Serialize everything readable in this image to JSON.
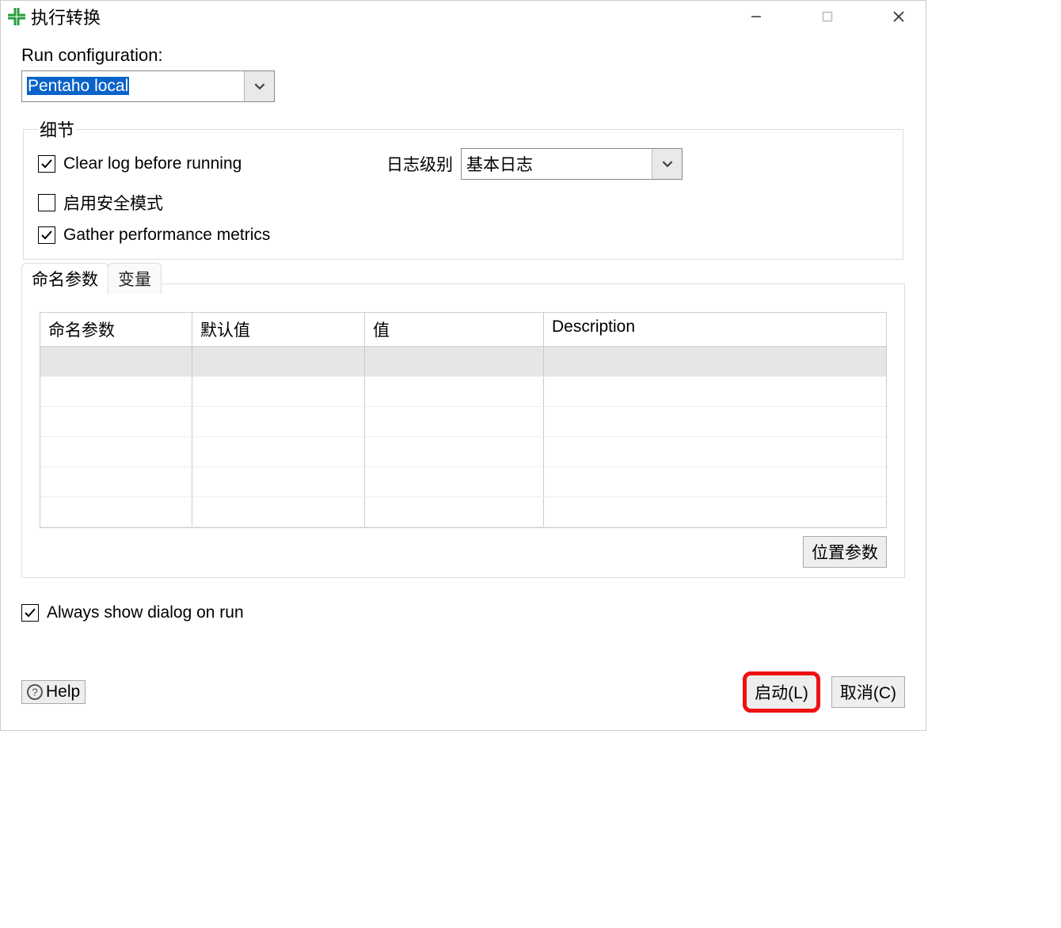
{
  "titlebar": {
    "title": "执行转换"
  },
  "run_config": {
    "label": "Run configuration:",
    "value": "Pentaho local"
  },
  "details": {
    "legend": "细节",
    "clear_log": {
      "label": "Clear log before running",
      "checked": true
    },
    "safe_mode": {
      "label": "启用安全模式",
      "checked": false
    },
    "gather_metrics": {
      "label": "Gather performance metrics",
      "checked": true
    },
    "log_level": {
      "label": "日志级别",
      "value": "基本日志"
    }
  },
  "tabs": {
    "named_params": "命名参数",
    "variables": "变量"
  },
  "table": {
    "headers": {
      "name": "命名参数",
      "default": "默认值",
      "value": "值",
      "description": "Description"
    }
  },
  "buttons": {
    "position_args": "位置参数",
    "help": "Help",
    "launch": "启动(L)",
    "cancel": "取消(C)"
  },
  "always_show": {
    "label": "Always show dialog on run",
    "checked": true
  }
}
